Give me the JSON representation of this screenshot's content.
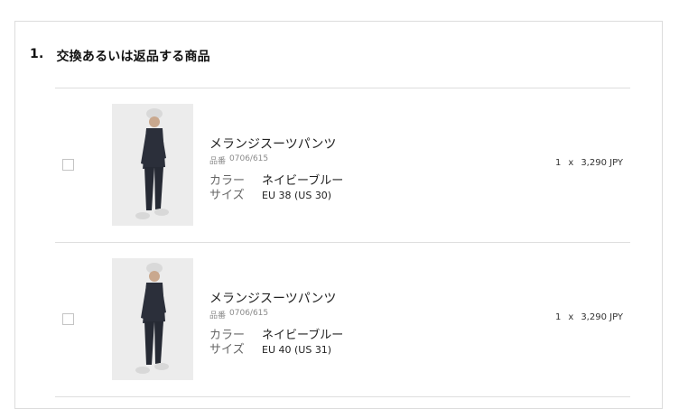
{
  "section": {
    "number": "1.",
    "title": "交換あるいは返品する商品"
  },
  "items": [
    {
      "name": "メランジスーツパンツ",
      "ref_label": "品番",
      "ref": "0706/615",
      "color_label": "カラー",
      "color": "ネイビーブルー",
      "size_label": "サイズ",
      "size": "EU 38 (US 30)",
      "qty": "1",
      "times": "x",
      "price": "3,290 JPY"
    },
    {
      "name": "メランジスーツパンツ",
      "ref_label": "品番",
      "ref": "0706/615",
      "color_label": "カラー",
      "color": "ネイビーブルー",
      "size_label": "サイズ",
      "size": "EU 40 (US 31)",
      "qty": "1",
      "times": "x",
      "price": "3,290 JPY"
    }
  ]
}
